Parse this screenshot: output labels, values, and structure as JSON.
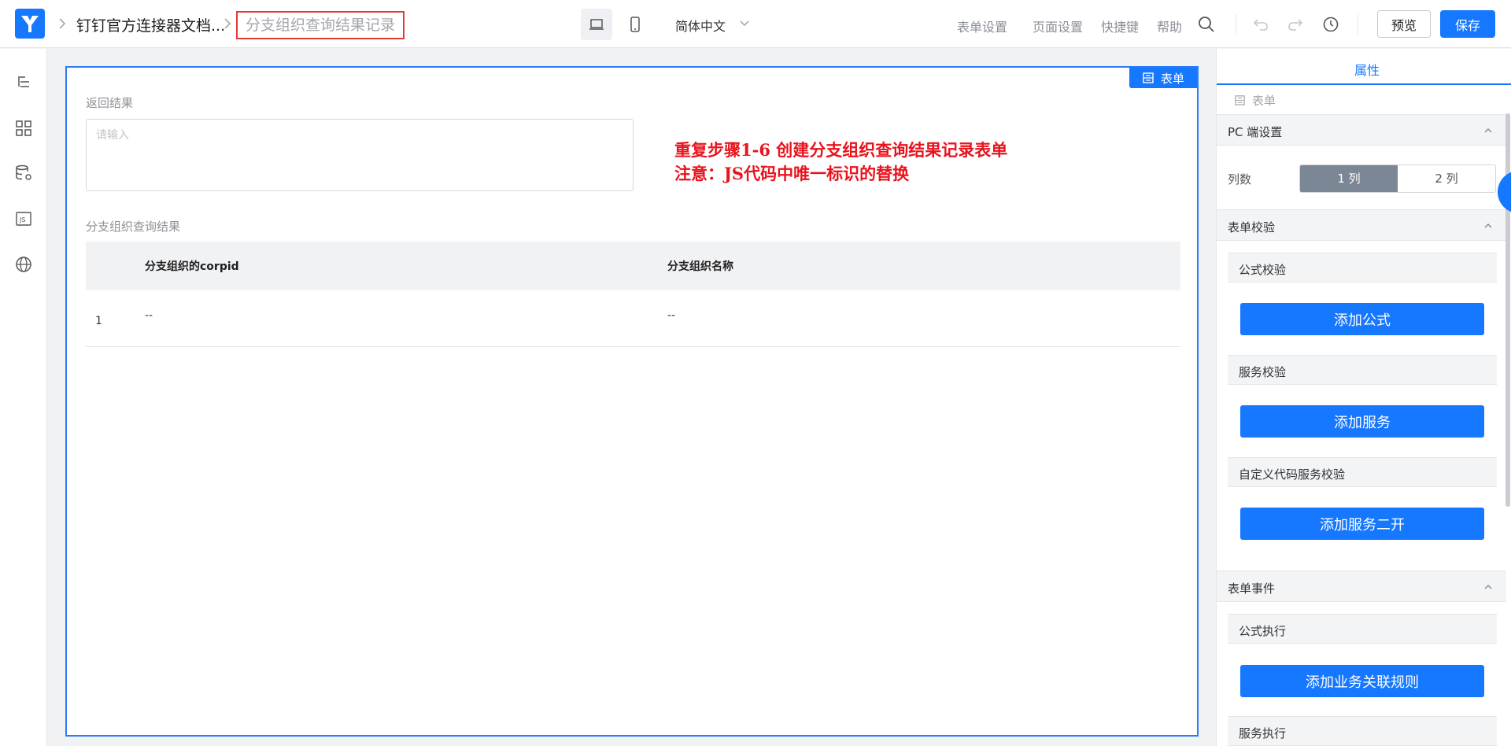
{
  "header": {
    "app_name": "钉钉官方连接器文档...",
    "page_name": "分支组织查询结果记录",
    "language": "简体中文",
    "links": [
      "表单设置",
      "页面设置",
      "快捷键",
      "帮助"
    ],
    "preview_label": "预览",
    "save_label": "保存"
  },
  "canvas": {
    "tag_label": "表单",
    "field1_label": "返回结果",
    "field1_placeholder": "请输入",
    "annotation_line1": "重复步骤1-6 创建分支组织查询结果记录表单",
    "annotation_line2": "注意：JS代码中唯一标识的替换",
    "table_label": "分支组织查询结果",
    "table": {
      "columns": [
        "分支组织的corpid",
        "分支组织名称"
      ],
      "rows": [
        {
          "index": "1",
          "cells": [
            "--",
            "--"
          ]
        }
      ]
    }
  },
  "rpanel": {
    "tab_label": "属性",
    "crumb": "表单",
    "pc_section": "PC 端设置",
    "cols_label": "列数",
    "cols_options": [
      "1 列",
      "2 列"
    ],
    "cols_selected": "1 列",
    "validation_section": "表单校验",
    "formula_validation": "公式校验",
    "add_formula": "添加公式",
    "service_validation": "服务校验",
    "add_service": "添加服务",
    "custom_validation": "自定义代码服务校验",
    "add_service_dev": "添加服务二开",
    "events_section": "表单事件",
    "formula_exec": "公式执行",
    "add_rule": "添加业务关联规则",
    "service_exec": "服务执行"
  },
  "colors": {
    "primary": "#1677ff",
    "annotation_red": "#e8131c",
    "highlight_box": "#e53935"
  }
}
